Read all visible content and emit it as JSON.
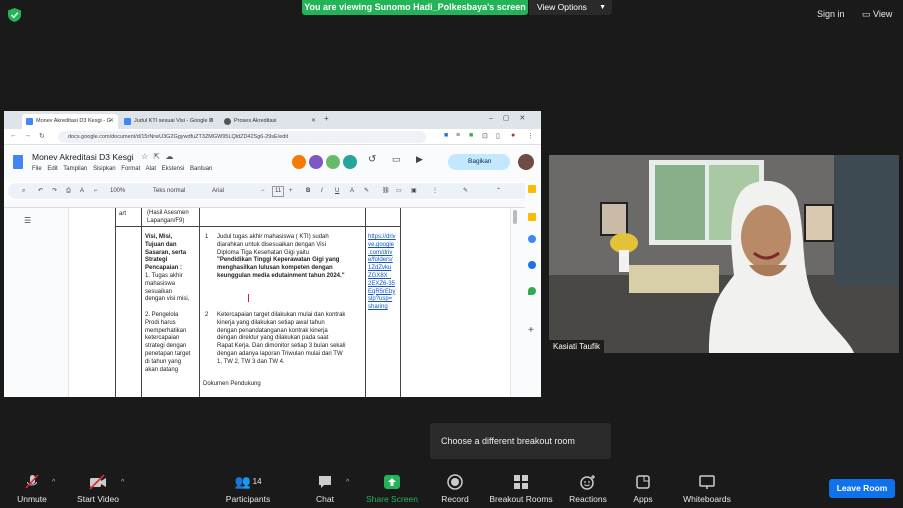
{
  "top": {
    "banner": "You are viewing Sunomo Hadi_Polkesbaya's screen",
    "view_options": "View Options",
    "sign_in": "Sign in",
    "view": "View"
  },
  "browser": {
    "tabs": [
      {
        "label": "Monev Akreditasi D3 Kesgi - G",
        "color": "#4285f4"
      },
      {
        "label": "Judul KTI sesuai Visi - Google D",
        "color": "#4285f4"
      },
      {
        "label": "Proses Akreditasi",
        "color": "#555555"
      }
    ],
    "url": "docs.google.com/document/d/15rNrwU3G2GgywdfuZT3ZMGW95LQldZD42Sg6-29sE/edit",
    "doc_title": "Monev Akreditasi D3 Kesgi",
    "menus": [
      "File",
      "Edit",
      "Tampilan",
      "Sisipkan",
      "Format",
      "Alat",
      "Ekstensi",
      "Bantuan"
    ],
    "share_label": "Bagikan",
    "toolbar": {
      "zoom": "100%",
      "style": "Teks normal",
      "font": "Arial",
      "font_size": "11"
    },
    "table": {
      "top_left": "art",
      "top_col2": "(Hasil Asesmen Lapangan/F9)",
      "left_cell_lines": [
        "Visi, Misi,",
        "Tujuan dan",
        "Sasaran, serta",
        "Strategi",
        "Pencapaian :",
        "1. Tugas akhir",
        "mahasiswa",
        "sesuaikan",
        "dengan visi misi,",
        "",
        "2. Pengelola",
        "Prodi harus",
        "memperhatikan",
        "ketercapaian",
        "strategi dengan",
        "penetapan target",
        "di tahun yang",
        "akan datang"
      ],
      "item1_lines": [
        "Judul tugas akhir mahasiswa ( KTI) sudah",
        "diarahkan untuk disesuaikan dengan Visi",
        "Diploma Tiga Kesehatan Gigi  yaitu",
        "\"Pendidikan Tinggi Keperawatan Gigi yang",
        "menghasilkan lulusan kompeten dengan",
        "keunggulan media edutainment tahun 2024.\""
      ],
      "item1_num": "1",
      "item2_num": "2",
      "item2_lines": [
        "Ketercapaian target dilakukan mulai dan kontrak",
        "kinerja yang dilakukan setiap awal tahun",
        "dengan penandatanganan kontrak kinerja",
        "dengan direktur yang dilakukan pada saat",
        "Rapat Kerja. Dan dimonitor setiap 3 bulan sekali",
        "dengan adanya laporan Triwulan mulai dari TW",
        "1, TW 2, TW 3 dan TW 4."
      ],
      "dokumen": "Dokumen Pendukung",
      "link_lines": [
        "https://driv",
        "ve.google",
        ".com/driv",
        "e/folders/",
        "1ZdZvku",
        "ZGX8X_",
        "2EXZ6-35",
        "EqR5rEby",
        "slp?usp=",
        "sharing"
      ]
    }
  },
  "webcam": {
    "name": "Kasiati Taufik"
  },
  "tooltip": "Choose a different breakout room",
  "toolbar": {
    "unmute": "Unmute",
    "start_video": "Start Video",
    "participants": "Participants",
    "participants_count": "14",
    "chat": "Chat",
    "share_screen": "Share Screen",
    "record": "Record",
    "breakout": "Breakout Rooms",
    "reactions": "Reactions",
    "apps": "Apps",
    "whiteboards": "Whiteboards",
    "leave": "Leave Room"
  },
  "colors": {
    "banner": "#23b45a",
    "leave": "#0e72ed",
    "share": "#23b45a"
  }
}
